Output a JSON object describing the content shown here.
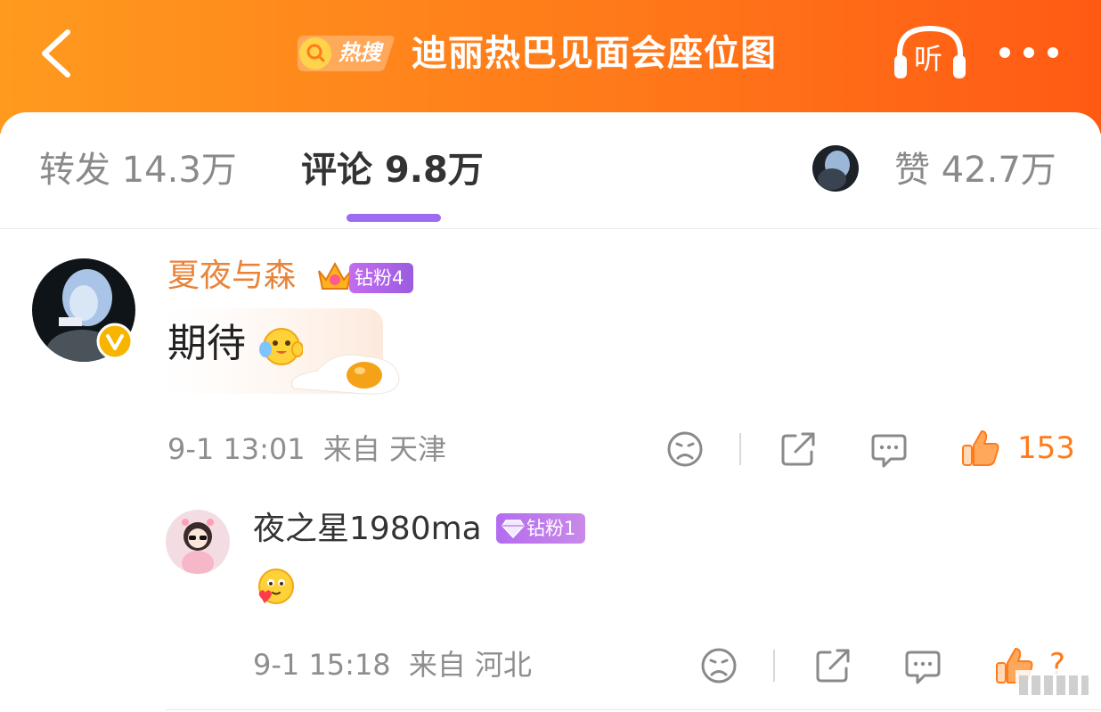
{
  "header": {
    "title": "迪丽热巴见面会座位图",
    "hot_badge_label": "热搜",
    "listen_label": "听"
  },
  "tabs": [
    {
      "label": "转发 14.3万",
      "active": false
    },
    {
      "label": "评论 9.8万",
      "active": true
    },
    {
      "label": "赞 42.7万",
      "active": false
    }
  ],
  "comment": {
    "username": "夏夜与森",
    "fan_badge": "钻粉4",
    "text": "期待",
    "timestamp": "9-1 13:01",
    "location": "来自 天津",
    "likes": "153"
  },
  "reply": {
    "username": "夜之星1980ma",
    "fan_badge": "钻粉1",
    "timestamp": "9-1 15:18",
    "location": "来自 河北",
    "likes": "?"
  },
  "colors": {
    "header_gradient_start": "#ff9a1e",
    "header_gradient_end": "#ff5a14",
    "username": "#e8843a",
    "tab_indicator": "#9b6cf0",
    "like_active": "#ff7a1a",
    "muted_text": "#8e8e8e"
  },
  "icons": [
    "back-arrow-icon",
    "search-icon",
    "listen-headphones-icon",
    "more-icon",
    "verified-v-icon",
    "crown-icon",
    "diamond-icon",
    "dislike-face-icon",
    "share-icon",
    "comment-icon",
    "thumbs-up-icon"
  ]
}
